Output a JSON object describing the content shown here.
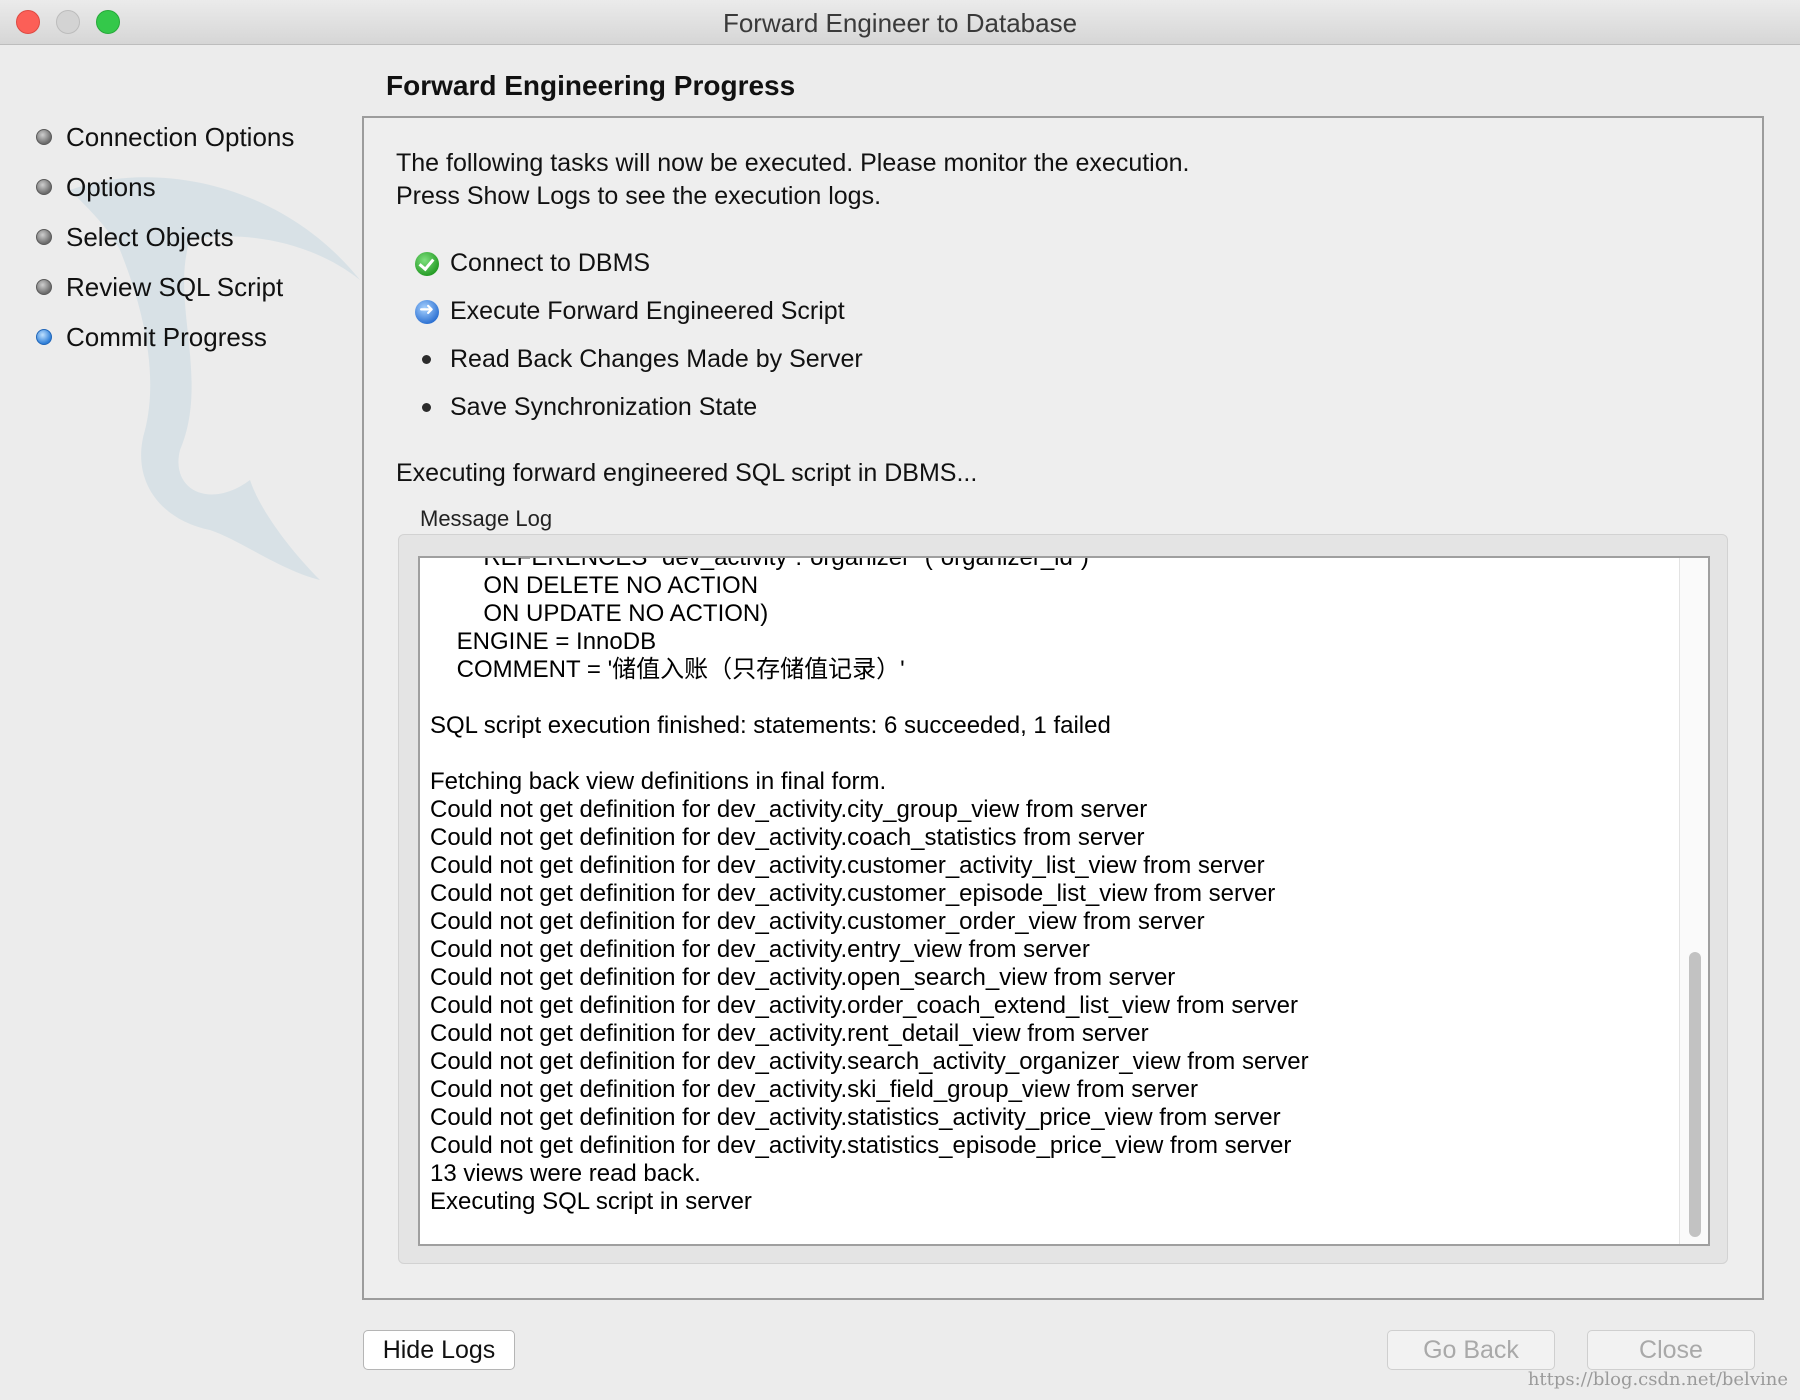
{
  "window": {
    "title": "Forward Engineer to Database"
  },
  "sidebar": {
    "items": [
      {
        "label": "Connection Options",
        "state": "done"
      },
      {
        "label": "Options",
        "state": "done"
      },
      {
        "label": "Select Objects",
        "state": "done"
      },
      {
        "label": "Review SQL Script",
        "state": "done"
      },
      {
        "label": "Commit Progress",
        "state": "active"
      }
    ]
  },
  "main": {
    "title": "Forward Engineering Progress",
    "intro_line1": "The following tasks will now be executed. Please monitor the execution.",
    "intro_line2": "Press Show Logs to see the execution logs.",
    "tasks": [
      {
        "label": "Connect to DBMS",
        "status": "done"
      },
      {
        "label": "Execute Forward Engineered Script",
        "status": "running"
      },
      {
        "label": "Read Back Changes Made by Server",
        "status": "pending"
      },
      {
        "label": "Save Synchronization State",
        "status": "pending"
      }
    ],
    "status_text": "Executing forward engineered SQL script in DBMS...",
    "log_label": "Message Log",
    "log_lines": [
      "        REFERENCES `dev_activity`.`organizer` (`organizer_id`)",
      "        ON DELETE NO ACTION",
      "        ON UPDATE NO ACTION)",
      "    ENGINE = InnoDB",
      "    COMMENT = '储值入账（只存储值记录）'",
      "",
      "SQL script execution finished: statements: 6 succeeded, 1 failed",
      "",
      "Fetching back view definitions in final form.",
      "Could not get definition for dev_activity.city_group_view from server",
      "Could not get definition for dev_activity.coach_statistics from server",
      "Could not get definition for dev_activity.customer_activity_list_view from server",
      "Could not get definition for dev_activity.customer_episode_list_view from server",
      "Could not get definition for dev_activity.customer_order_view from server",
      "Could not get definition for dev_activity.entry_view from server",
      "Could not get definition for dev_activity.open_search_view from server",
      "Could not get definition for dev_activity.order_coach_extend_list_view from server",
      "Could not get definition for dev_activity.rent_detail_view from server",
      "Could not get definition for dev_activity.search_activity_organizer_view from server",
      "Could not get definition for dev_activity.ski_field_group_view from server",
      "Could not get definition for dev_activity.statistics_activity_price_view from server",
      "Could not get definition for dev_activity.statistics_episode_price_view from server",
      "13 views were read back.",
      "Executing SQL script in server"
    ]
  },
  "buttons": {
    "hide_logs": "Hide Logs",
    "go_back": "Go Back",
    "close": "Close"
  },
  "watermark": "https://blog.csdn.net/belvine"
}
